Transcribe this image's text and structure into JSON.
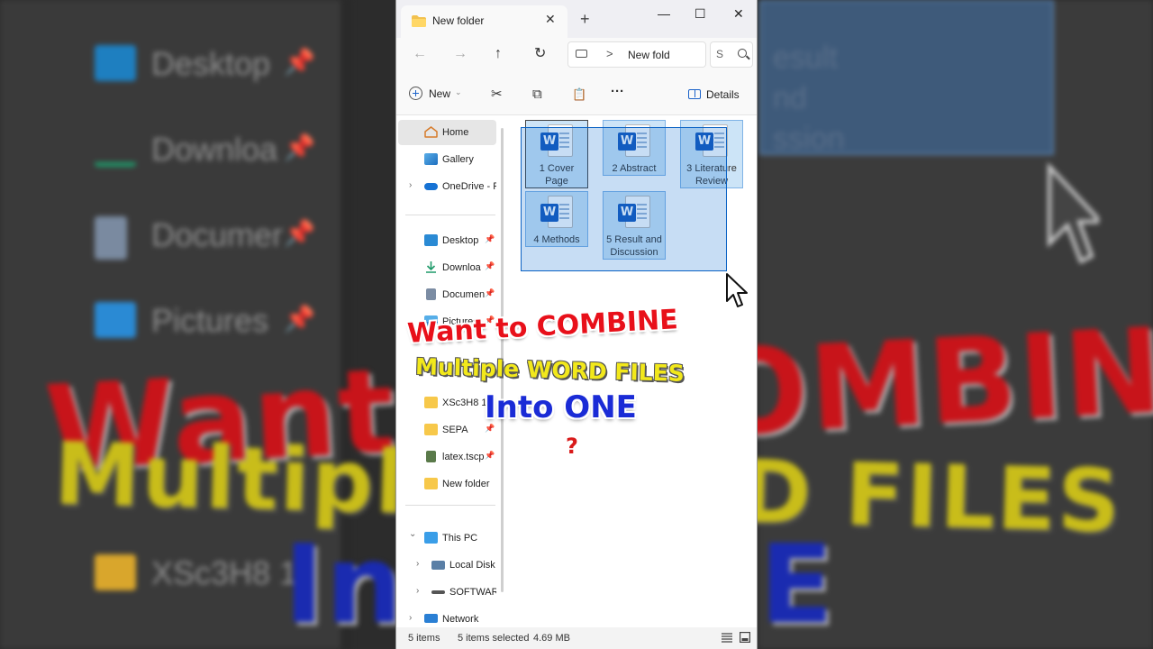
{
  "window": {
    "tab_title": "New folder",
    "tab_close": "✕",
    "new_tab": "+",
    "minimize": "—",
    "maximize": "☐",
    "close": "✕"
  },
  "address": {
    "back": "←",
    "forward": "→",
    "up": "↑",
    "refresh": "↻",
    "chevron": ">",
    "path": "New fold",
    "search_placeholder": "S"
  },
  "toolbar": {
    "new_label": "New",
    "new_chevron": "⌄",
    "cut": "✂",
    "copy": "⧉",
    "paste": "📋",
    "more": "···",
    "details_label": "Details"
  },
  "nav": {
    "home": "Home",
    "gallery": "Gallery",
    "onedrive": "OneDrive - P",
    "pinned": [
      {
        "label": "Desktop",
        "icon": "desktop-icon"
      },
      {
        "label": "Downloa",
        "icon": "downloads-icon"
      },
      {
        "label": "Documen",
        "icon": "documents-icon"
      },
      {
        "label": "Pictures",
        "icon": "pictures-icon"
      },
      {
        "label": "XSc3H8 1",
        "icon": "folder-icon"
      },
      {
        "label": "SEPA",
        "icon": "folder-icon"
      },
      {
        "label": "latex.tscp",
        "icon": "file-icon"
      },
      {
        "label": "New folder",
        "icon": "folder-icon"
      }
    ],
    "this_pc": "This PC",
    "local_disk": "Local Disk",
    "software": "SOFTWARI",
    "network": "Network",
    "expand": "›",
    "collapse": "⌄",
    "pin": "📌"
  },
  "files": [
    {
      "name": "1 Cover Page"
    },
    {
      "name": "2 Abstract"
    },
    {
      "name": "3 Literature Review"
    },
    {
      "name": "4 Methods"
    },
    {
      "name": "5 Result and Discussion"
    }
  ],
  "status": {
    "items": "5 items",
    "selected": "5 items selected",
    "size": "4.69 MB"
  },
  "overlay": {
    "line1": "Want to COMBINE",
    "line2": "Multiple WORD FILES",
    "line3": "Into ONE",
    "line4": "?"
  },
  "background": {
    "items": [
      "Desktop",
      "Downloa",
      "Documer",
      "Pictures",
      "XSc3H8 1"
    ],
    "right_text": [
      "esult",
      "nd",
      "ssion"
    ],
    "big1": "Want to COMBINE",
    "big2": "Multiple WORD FILES",
    "big3": "Into ONE"
  },
  "colors": {
    "accent": "#185abd",
    "selection": "#cce4f7",
    "caption_red": "#e8101a",
    "caption_yellow": "#f2e81b",
    "caption_blue": "#1a2bd6"
  }
}
